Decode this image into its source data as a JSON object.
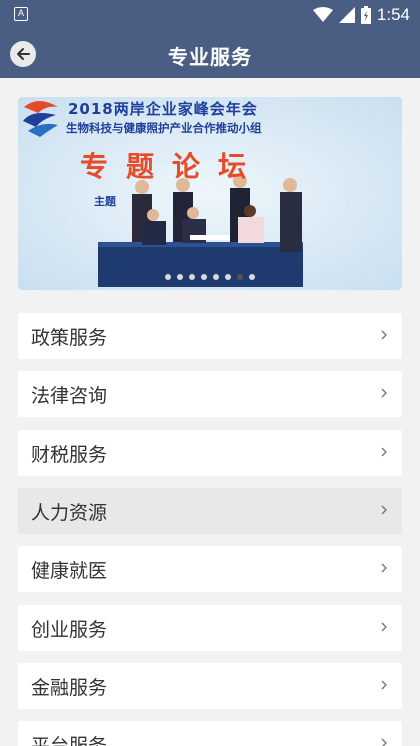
{
  "status": {
    "time": "1:54",
    "app_icon_letter": "A"
  },
  "header": {
    "title": "专业服务"
  },
  "banner": {
    "line1": "2018两岸企业家峰会年会",
    "line2": "生物科技与健康照护产业合作推动小组",
    "line3": "专题论坛",
    "line4": "主题",
    "dot_count": 8,
    "active_dot": 6
  },
  "menu": {
    "items": [
      {
        "label": "政策服务",
        "highlighted": false
      },
      {
        "label": "法律咨询",
        "highlighted": false
      },
      {
        "label": "财税服务",
        "highlighted": false
      },
      {
        "label": "人力资源",
        "highlighted": true
      },
      {
        "label": "健康就医",
        "highlighted": false
      },
      {
        "label": "创业服务",
        "highlighted": false
      },
      {
        "label": "金融服务",
        "highlighted": false
      },
      {
        "label": "平台服务",
        "highlighted": false
      }
    ]
  },
  "colors": {
    "primary": "#4a5d83",
    "background": "#f2f2f2",
    "highlight": "#e8e8e8"
  }
}
